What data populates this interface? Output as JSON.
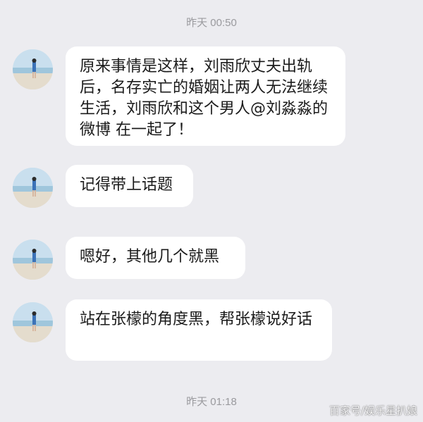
{
  "timestamps": {
    "top": "昨天 00:50",
    "bottom": "昨天 01:18"
  },
  "messages": [
    {
      "text": "原来事情是这样，刘雨欣丈夫出轨后，名存实亡的婚姻让两人无法继续生活，刘雨欣和这个男人@刘淼淼的微博 在一起了！"
    },
    {
      "text": "记得带上话题"
    },
    {
      "text": "嗯好，其他几个就黑"
    },
    {
      "text": "站在张檬的角度黑，帮张檬说好话"
    }
  ],
  "watermark": "百家号/娱乐星扒娘",
  "colors": {
    "background": "#ececf0",
    "bubble": "#ffffff",
    "timestamp": "#9a9a9e",
    "text": "#1b1b1b"
  }
}
